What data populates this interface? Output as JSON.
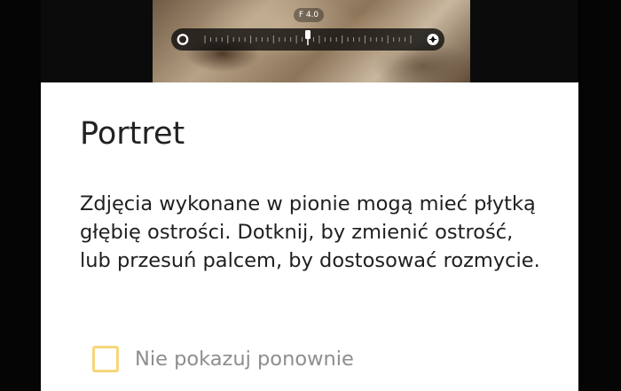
{
  "camera": {
    "aperture_label": "F 4.0",
    "aperture_value": 4.0,
    "slider_position": 0.5,
    "slider_left_icon": "aperture-open-icon",
    "slider_right_icon": "aperture-closed-icon"
  },
  "dialog": {
    "title": "Portret",
    "body": "Zdjęcia wykonane w pionie mogą mieć płytką głębię ostrości. Dotknij, by zmienić ostrość, lub przesuń palcem, by dostosować rozmycie.",
    "checkbox_label": "Nie pokazuj ponownie",
    "checkbox_checked": false
  },
  "colors": {
    "dialog_background": "#ffffff",
    "checkbox_border": "#f6d77a",
    "label_gray": "#8e8e8e",
    "text_dark": "#1f1f1f"
  }
}
